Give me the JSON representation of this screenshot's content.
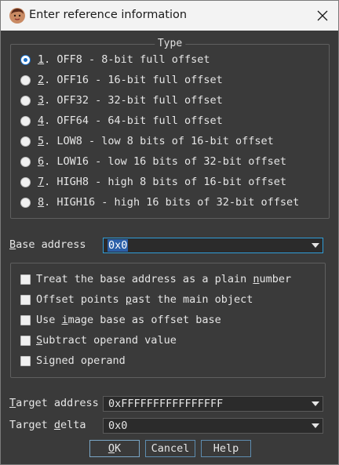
{
  "window": {
    "title": "Enter reference information"
  },
  "type_group": {
    "legend": "Type",
    "selected_index": 0,
    "options": [
      {
        "key": "1",
        "label": "OFF8 - 8-bit full offset"
      },
      {
        "key": "2",
        "label": "OFF16 - 16-bit full offset"
      },
      {
        "key": "3",
        "label": "OFF32 - 32-bit full offset"
      },
      {
        "key": "4",
        "label": "OFF64 - 64-bit full offset"
      },
      {
        "key": "5",
        "label": "LOW8 - low 8 bits of 16-bit offset"
      },
      {
        "key": "6",
        "label": "LOW16 - low 16 bits of 32-bit offset"
      },
      {
        "key": "7",
        "label": "HIGH8 - high 8 bits of 16-bit offset"
      },
      {
        "key": "8",
        "label": "HIGH16 - high 16 bits of 32-bit offset"
      }
    ]
  },
  "base_address": {
    "label_key": "B",
    "label_rest": "ase address",
    "value": "0x0"
  },
  "options": [
    {
      "pre": "Treat the base address as a plain ",
      "key": "n",
      "post": "umber",
      "checked": false
    },
    {
      "pre": "Offset points ",
      "key": "p",
      "post": "ast the main object",
      "checked": false
    },
    {
      "pre": "Use ",
      "key": "i",
      "post": "mage base as offset base",
      "checked": false
    },
    {
      "pre": "",
      "key": "S",
      "post": "ubtract operand value",
      "checked": false
    },
    {
      "pre": "Signed operand",
      "key": "",
      "post": "",
      "checked": false
    }
  ],
  "target_address": {
    "label_key": "T",
    "label_rest": "arget address",
    "value": "0xFFFFFFFFFFFFFFFF"
  },
  "target_delta": {
    "label_pre": "Target ",
    "label_key": "d",
    "label_rest": "elta",
    "value": "0x0"
  },
  "buttons": {
    "ok": {
      "key": "O",
      "rest": "K"
    },
    "cancel": "Cancel",
    "help": "Help"
  },
  "colors": {
    "background": "#3a3a3a",
    "accent": "#1a6fc9",
    "focus": "#2f9dd8",
    "text": "#e6e6e6"
  }
}
